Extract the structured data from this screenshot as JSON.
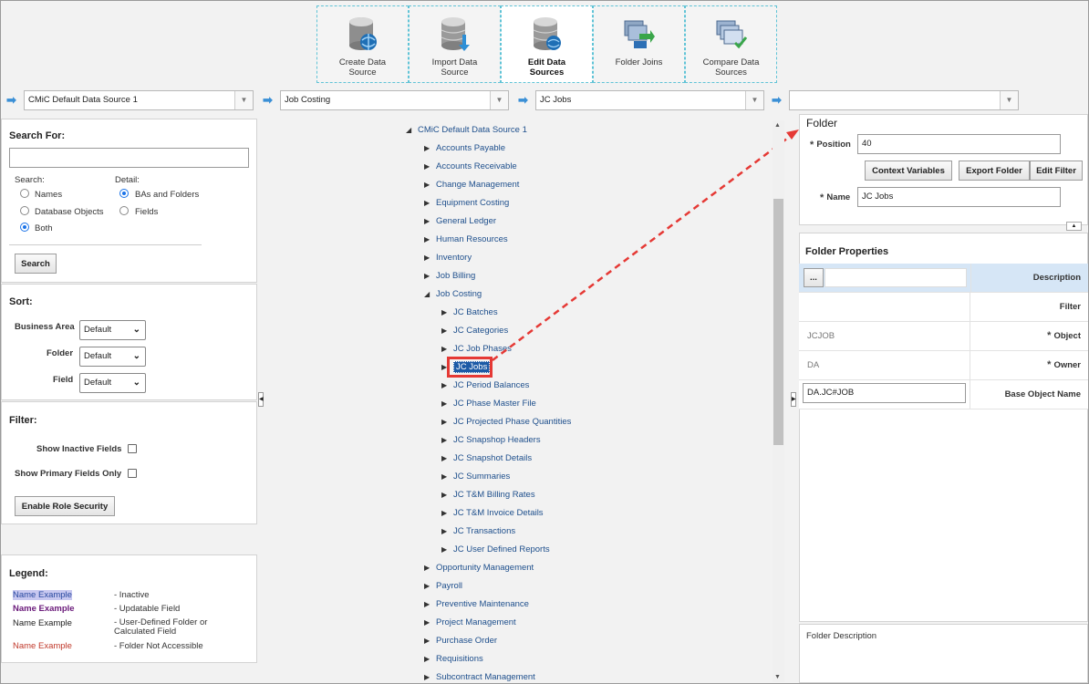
{
  "toolbar": {
    "buttons": [
      {
        "label": "Create Data Source"
      },
      {
        "label": "Import Data Source"
      },
      {
        "label": "Edit Data Sources"
      },
      {
        "label": "Folder Joins"
      },
      {
        "label": "Compare Data Sources"
      }
    ]
  },
  "nav": {
    "data_source": "CMiC Default Data Source 1",
    "business_area": "Job Costing",
    "folder": "JC Jobs",
    "item": ""
  },
  "search": {
    "title": "Search For:",
    "input_value": "",
    "search_label": "Search:",
    "detail_label": "Detail:",
    "opt_names": "Names",
    "opt_db_objects": "Database Objects",
    "opt_both": "Both",
    "opt_bas_folders": "BAs and Folders",
    "opt_fields": "Fields",
    "button": "Search"
  },
  "sort": {
    "title": "Sort:",
    "business_area_label": "Business Area",
    "folder_label": "Folder",
    "field_label": "Field",
    "business_area_value": "Default",
    "folder_value": "Default",
    "field_value": "Default"
  },
  "filter": {
    "title": "Filter:",
    "show_inactive": "Show Inactive Fields",
    "show_primary": "Show Primary Fields Only",
    "enable_role_security": "Enable Role Security"
  },
  "legend": {
    "title": "Legend:",
    "items": [
      {
        "example": "Name Example",
        "desc": "- Inactive"
      },
      {
        "example": "Name Example",
        "desc": "- Updatable Field"
      },
      {
        "example": "Name Example",
        "desc": "- User-Defined Folder or Calculated Field"
      },
      {
        "example": "Name Example",
        "desc": "- Folder Not Accessible"
      }
    ],
    "colors": {
      "inactive_bg": "#c8c8f0",
      "inactive_text": "#2a4aa0",
      "updatable": "#6a1a7a",
      "normal": "#222222",
      "not_accessible": "#c0392b"
    }
  },
  "tree": {
    "root": "CMiC Default Data Source 1",
    "items": [
      "Accounts Payable",
      "Accounts Receivable",
      "Change Management",
      "Equipment Costing",
      "General Ledger",
      "Human Resources",
      "Inventory",
      "Job Billing",
      "Job Costing",
      "JC Batches",
      "JC Categories",
      "JC Job Phases",
      "JC Jobs",
      "JC Period Balances",
      "JC Phase Master File",
      "JC Projected Phase Quantities",
      "JC Snapshop Headers",
      "JC Snapshot Details",
      "JC Summaries",
      "JC T&M Billing Rates",
      "JC T&M Invoice Details",
      "JC Transactions",
      "JC User Defined Reports",
      "Opportunity Management",
      "Payroll",
      "Preventive Maintenance",
      "Project Management",
      "Purchase Order",
      "Requisitions",
      "Subcontract Management"
    ]
  },
  "folder": {
    "title": "Folder",
    "position_label": "Position",
    "position_value": "40",
    "context_variables": "Context Variables",
    "export_folder": "Export Folder",
    "edit_filter": "Edit Filter",
    "name_label": "Name",
    "name_value": "JC Jobs"
  },
  "properties": {
    "title": "Folder Properties",
    "ellipsis": "...",
    "header_key": "Description",
    "rows": [
      {
        "value": "",
        "key": "Filter"
      },
      {
        "value": "JCJOB",
        "key": "Object"
      },
      {
        "value": "DA",
        "key": "Owner"
      },
      {
        "value": "DA.JC#JOB",
        "key": "Base Object Name"
      }
    ],
    "description_label": "Folder Description"
  }
}
